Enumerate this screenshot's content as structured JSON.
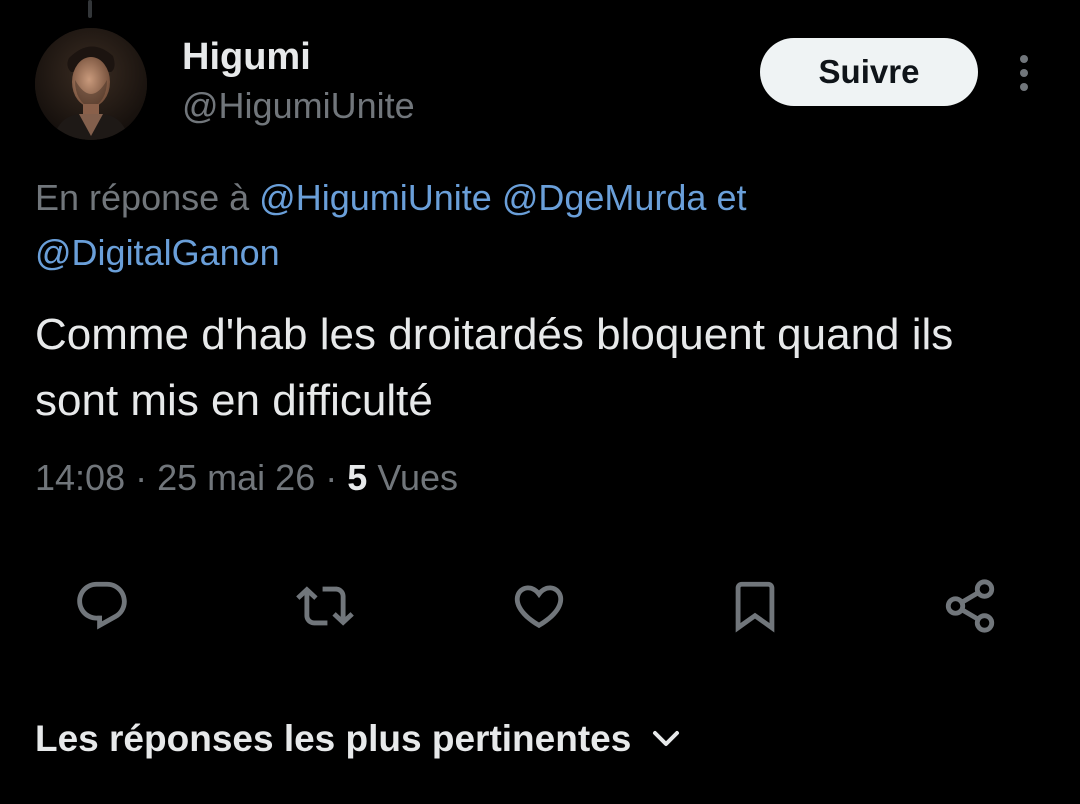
{
  "tweet": {
    "author": {
      "name": "Higumi",
      "handle": "@HigumiUnite"
    },
    "follow_label": "Suivre",
    "reply_context": {
      "prefix": "En réponse à",
      "mention1": "@HigumiUnite",
      "mention2": "@DgeMurda",
      "conjunction": "et",
      "mention3": "@DigitalGanon"
    },
    "text": "Comme d'hab les droitardés bloquent quand ils sont mis en difficulté",
    "meta": {
      "time": "14:08",
      "separator": "·",
      "date": "25 mai 26",
      "views_count": "5",
      "views_label": "Vues"
    }
  },
  "actions": [
    {
      "name": "reply",
      "icon": "speech-bubble-icon"
    },
    {
      "name": "retweet",
      "icon": "retweet-icon"
    },
    {
      "name": "like",
      "icon": "heart-icon"
    },
    {
      "name": "bookmark",
      "icon": "bookmark-icon"
    },
    {
      "name": "share",
      "icon": "share-icon"
    }
  ],
  "replies_sort": {
    "label": "Les réponses les plus pertinentes",
    "icon": "chevron-down-icon"
  },
  "colors": {
    "background": "#000000",
    "primary_text": "#e7e9ea",
    "secondary_text": "#71767b",
    "link": "#6a9fd9",
    "follow_button_bg": "#eff3f4"
  }
}
